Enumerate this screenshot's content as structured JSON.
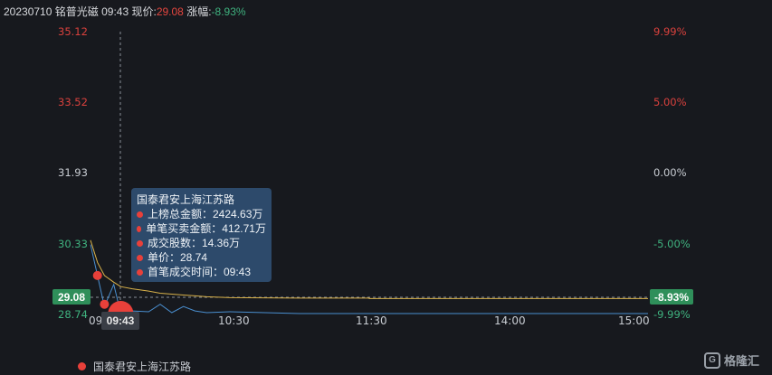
{
  "header": {
    "date": "20230710",
    "name": "铭普光磁",
    "time": "09:43",
    "price_label": "现价:",
    "price": "29.08",
    "change_label": "涨幅:",
    "change": "-8.93%"
  },
  "y_left": [
    "35.12",
    "33.52",
    "31.93",
    "30.33",
    "28.74"
  ],
  "y_right": [
    "9.99%",
    "5.00%",
    "0.00%",
    "-5.00%",
    "-9.99%"
  ],
  "x_labels": [
    "09",
    "10:30",
    "11:30",
    "14:00",
    "15:00"
  ],
  "current_price_tag": "29.08",
  "current_change_tag": "-8.93%",
  "cursor_time_tag": "09:43",
  "tooltip": {
    "title": "国泰君安上海江苏路",
    "rows": [
      "上榜总金额：2424.63万",
      "单笔买卖金额：412.71万",
      "成交股数：14.36万",
      "单价：28.74",
      "首笔成交时间：09:43"
    ]
  },
  "legend": {
    "label": "国泰君安上海江苏路"
  },
  "brand": {
    "logo_text": "G",
    "name": "格隆汇"
  },
  "colors": {
    "background": "#17191e",
    "up": "#d9413d",
    "down": "#3fb27f",
    "price_line": "#4a8fd0",
    "avg_line": "#d9b24a",
    "marker": "#e8403a",
    "tooltip_bg": "#2d4a6b"
  },
  "chart_data": {
    "type": "line",
    "title": "",
    "xlabel": "",
    "ylabel": "",
    "ylim": [
      28.74,
      35.12
    ],
    "prev_close": 31.93,
    "x": [
      "09:30",
      "09:33",
      "09:36",
      "09:40",
      "09:43",
      "09:48",
      "09:55",
      "10:00",
      "10:05",
      "10:10",
      "10:15",
      "10:20",
      "10:30",
      "11:00",
      "11:30",
      "13:00",
      "13:30",
      "14:00",
      "14:30",
      "15:00"
    ],
    "series": [
      {
        "values": [
          30.3,
          29.6,
          28.9,
          29.4,
          28.74,
          28.8,
          28.78,
          28.95,
          28.76,
          28.9,
          28.8,
          28.76,
          28.78,
          28.74,
          28.74,
          28.74,
          28.74,
          28.74,
          28.74,
          28.74
        ]
      },
      {
        "values": [
          30.4,
          29.9,
          29.6,
          29.45,
          29.35,
          29.3,
          29.25,
          29.2,
          29.18,
          29.16,
          29.14,
          29.12,
          29.1,
          29.09,
          29.09,
          29.08,
          29.08,
          29.08,
          29.08,
          29.08
        ]
      }
    ],
    "markers": [
      {
        "x": "09:33",
        "y": 29.6
      },
      {
        "x": "09:36",
        "y": 28.95
      },
      {
        "x": "09:43",
        "y": 28.74
      }
    ]
  }
}
